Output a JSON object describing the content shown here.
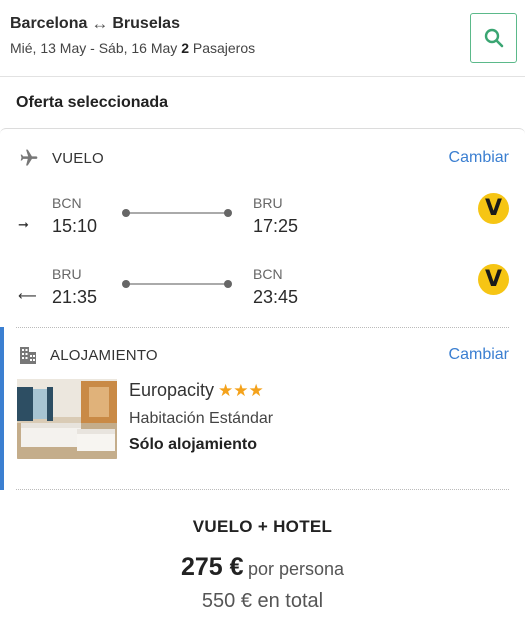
{
  "header": {
    "origin": "Barcelona",
    "destination": "Bruselas",
    "dates": "Mié, 13 May - Sáb, 16 May",
    "passenger_count": "2",
    "passenger_label": "Pasajeros"
  },
  "offer_title": "Oferta seleccionada",
  "flight": {
    "label": "VUELO",
    "change_label": "Cambiar",
    "legs": [
      {
        "direction_icon": "arrow-right-icon",
        "from_code": "BCN",
        "from_time": "15:10",
        "to_code": "BRU",
        "to_time": "17:25",
        "airline_logo": "V"
      },
      {
        "direction_icon": "arrow-left-icon",
        "from_code": "BRU",
        "from_time": "21:35",
        "to_code": "BCN",
        "to_time": "23:45",
        "airline_logo": "V"
      }
    ]
  },
  "hotel": {
    "label": "ALOJAMIENTO",
    "change_label": "Cambiar",
    "name": "Europacity",
    "stars": "★★★",
    "room": "Habitación Estándar",
    "board": "Sólo alojamiento"
  },
  "summary": {
    "title": "VUELO + HOTEL",
    "price": "275 €",
    "per_person": "por persona",
    "total": "550 € en total"
  },
  "colors": {
    "accent": "#3b7fd1",
    "search_border": "#5bb98a",
    "star": "#f4a21b",
    "airline": "#f6c514"
  }
}
